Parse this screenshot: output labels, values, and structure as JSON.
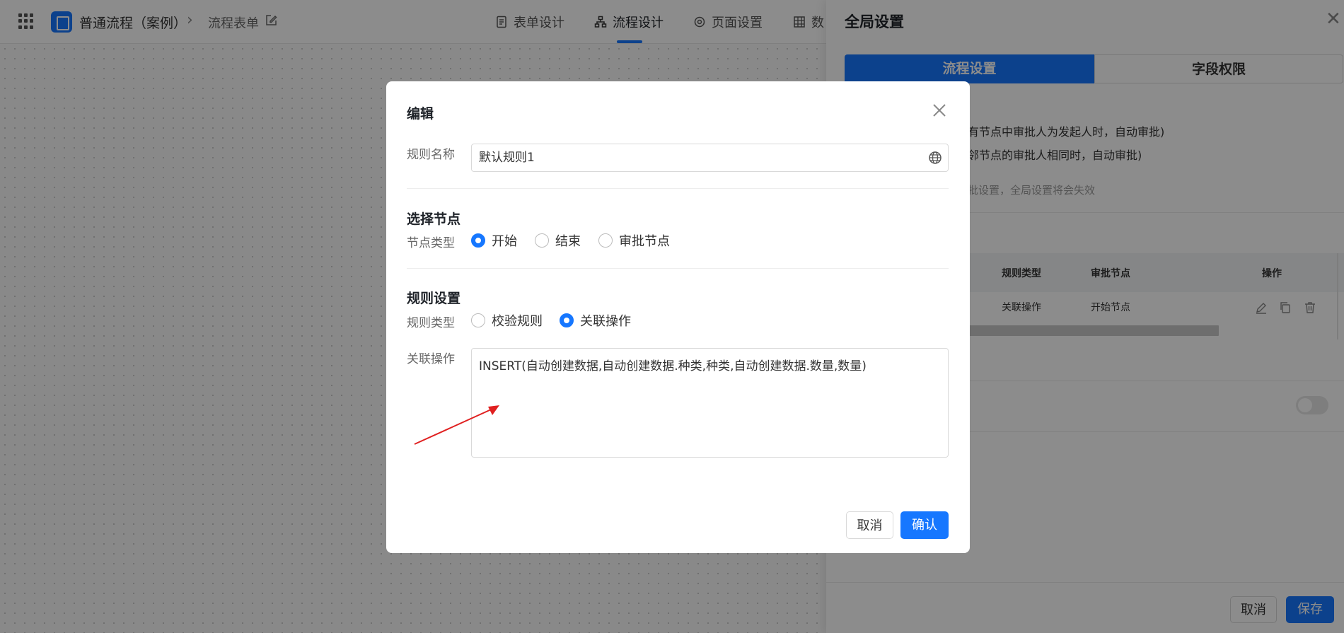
{
  "topbar": {
    "app_name": "普通流程（案例）",
    "breadcrumb_sep": "›",
    "breadcrumb_form": "流程表单",
    "nav": [
      {
        "label": "表单设计",
        "icon": "document-icon"
      },
      {
        "label": "流程设计",
        "icon": "flow-tree-icon",
        "active": true
      },
      {
        "label": "页面设置",
        "icon": "gear-icon"
      },
      {
        "label": "数",
        "icon": "table-icon"
      }
    ]
  },
  "panel": {
    "title": "全局设置",
    "close": "✕",
    "tabs": [
      "流程设置",
      "字段权限"
    ],
    "text_1": "有节点中审批人为发起人时，自动审批)",
    "text_2": "邻节点的审批人相同时，自动审批)",
    "text_3": "批设置，全局设置将会失效",
    "table": {
      "columns": [
        "规则类型",
        "审批节点",
        "操作"
      ],
      "rows": [
        {
          "rule_type": "关联操作",
          "node": "开始节点"
        }
      ]
    },
    "footer": {
      "cancel": "取消",
      "save": "保存"
    }
  },
  "modal": {
    "title": "编辑",
    "rule_name_label": "规则名称",
    "rule_name_value": "默认规则1",
    "node_section": "选择节点",
    "node_type_label": "节点类型",
    "node_options": [
      "开始",
      "结束",
      "审批节点"
    ],
    "node_selected": "开始",
    "rule_section": "规则设置",
    "rule_type_label": "规则类型",
    "rule_options": [
      "校验规则",
      "关联操作"
    ],
    "rule_selected": "关联操作",
    "action_label": "关联操作",
    "action_value": "INSERT(自动创建数据,自动创建数据.种类,种类,自动创建数据.数量,数量)",
    "cancel": "取消",
    "confirm": "确认"
  },
  "colors": {
    "accent": "#1677ff",
    "annotation": "#e02020"
  }
}
